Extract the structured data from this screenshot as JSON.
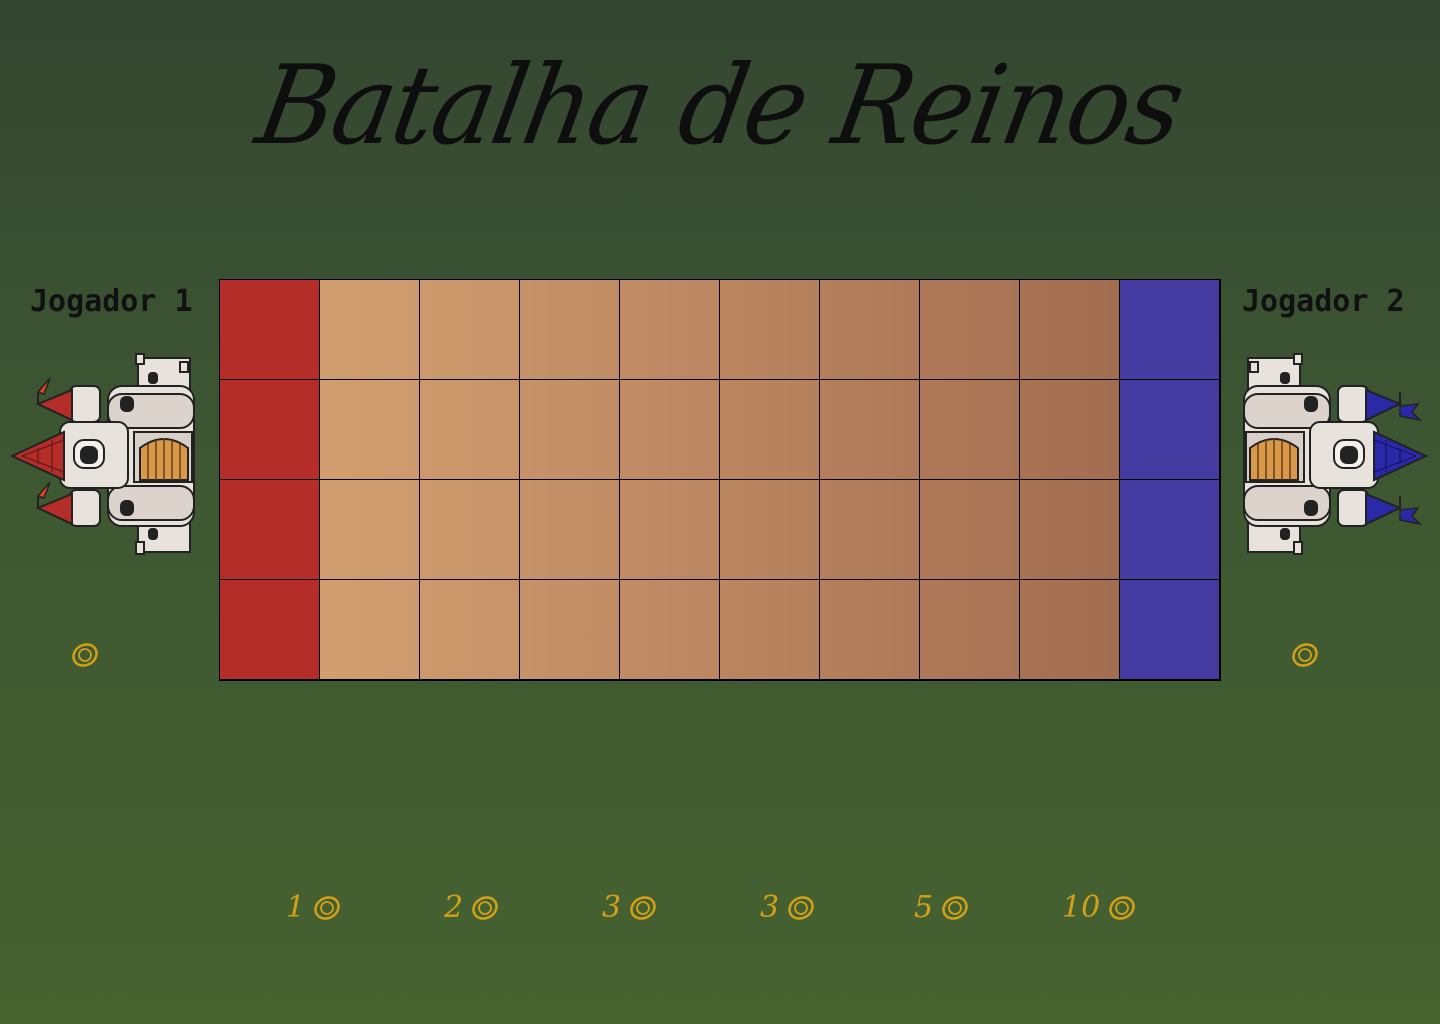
{
  "title": "Batalha de Reinos",
  "players": [
    {
      "label": "Jogador 1",
      "color": "#b52d28",
      "flag_color": "#e0451c",
      "roof_color": "#b52d28"
    },
    {
      "label": "Jogador 2",
      "color": "#443aa0",
      "flag_color": "#2a2aa8",
      "roof_color": "#2a2aa8"
    }
  ],
  "board": {
    "columns": 10,
    "rows": 4
  },
  "coin_color": "#d4a017",
  "costs": [
    {
      "value": "1"
    },
    {
      "value": "2"
    },
    {
      "value": "3"
    },
    {
      "value": "3"
    },
    {
      "value": "5"
    },
    {
      "value": "10"
    }
  ]
}
